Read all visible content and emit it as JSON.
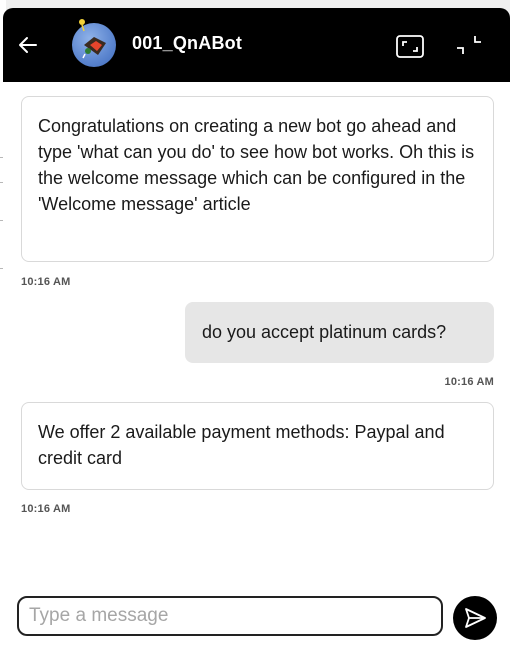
{
  "header": {
    "bot_name": "001_QnABot",
    "back_icon": "arrow-left-icon",
    "expand_icon": "expand-icon",
    "minimize_icon": "minimize-icon",
    "background": "#000000"
  },
  "messages": [
    {
      "sender": "bot",
      "text": "Congratulations on creating a new bot go ahead and type 'what can you do' to see how bot works. Oh this is the welcome message which can be configured in the 'Welcome message' article",
      "time": "10:16 AM"
    },
    {
      "sender": "user",
      "text": "do you accept platinum cards?",
      "time": "10:16 AM"
    },
    {
      "sender": "bot",
      "text": "We offer 2 available payment methods: Paypal and credit card",
      "time": "10:16 AM"
    }
  ],
  "composer": {
    "placeholder": "Type a message",
    "value": "",
    "send_icon": "send-icon"
  }
}
